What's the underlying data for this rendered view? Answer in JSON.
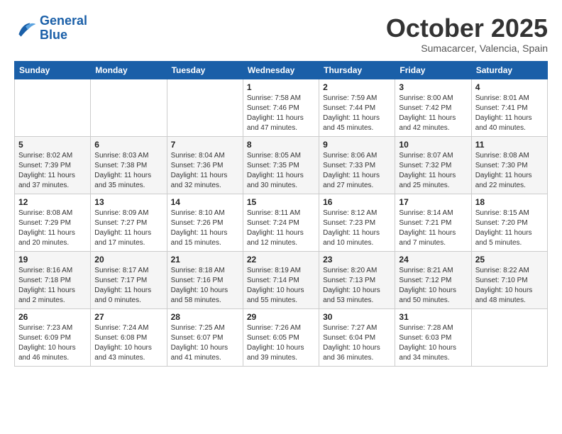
{
  "logo": {
    "line1": "General",
    "line2": "Blue"
  },
  "header": {
    "month": "October 2025",
    "location": "Sumacarcer, Valencia, Spain"
  },
  "days_of_week": [
    "Sunday",
    "Monday",
    "Tuesday",
    "Wednesday",
    "Thursday",
    "Friday",
    "Saturday"
  ],
  "weeks": [
    [
      {
        "day": "",
        "info": ""
      },
      {
        "day": "",
        "info": ""
      },
      {
        "day": "",
        "info": ""
      },
      {
        "day": "1",
        "info": "Sunrise: 7:58 AM\nSunset: 7:46 PM\nDaylight: 11 hours and 47 minutes."
      },
      {
        "day": "2",
        "info": "Sunrise: 7:59 AM\nSunset: 7:44 PM\nDaylight: 11 hours and 45 minutes."
      },
      {
        "day": "3",
        "info": "Sunrise: 8:00 AM\nSunset: 7:42 PM\nDaylight: 11 hours and 42 minutes."
      },
      {
        "day": "4",
        "info": "Sunrise: 8:01 AM\nSunset: 7:41 PM\nDaylight: 11 hours and 40 minutes."
      }
    ],
    [
      {
        "day": "5",
        "info": "Sunrise: 8:02 AM\nSunset: 7:39 PM\nDaylight: 11 hours and 37 minutes."
      },
      {
        "day": "6",
        "info": "Sunrise: 8:03 AM\nSunset: 7:38 PM\nDaylight: 11 hours and 35 minutes."
      },
      {
        "day": "7",
        "info": "Sunrise: 8:04 AM\nSunset: 7:36 PM\nDaylight: 11 hours and 32 minutes."
      },
      {
        "day": "8",
        "info": "Sunrise: 8:05 AM\nSunset: 7:35 PM\nDaylight: 11 hours and 30 minutes."
      },
      {
        "day": "9",
        "info": "Sunrise: 8:06 AM\nSunset: 7:33 PM\nDaylight: 11 hours and 27 minutes."
      },
      {
        "day": "10",
        "info": "Sunrise: 8:07 AM\nSunset: 7:32 PM\nDaylight: 11 hours and 25 minutes."
      },
      {
        "day": "11",
        "info": "Sunrise: 8:08 AM\nSunset: 7:30 PM\nDaylight: 11 hours and 22 minutes."
      }
    ],
    [
      {
        "day": "12",
        "info": "Sunrise: 8:08 AM\nSunset: 7:29 PM\nDaylight: 11 hours and 20 minutes."
      },
      {
        "day": "13",
        "info": "Sunrise: 8:09 AM\nSunset: 7:27 PM\nDaylight: 11 hours and 17 minutes."
      },
      {
        "day": "14",
        "info": "Sunrise: 8:10 AM\nSunset: 7:26 PM\nDaylight: 11 hours and 15 minutes."
      },
      {
        "day": "15",
        "info": "Sunrise: 8:11 AM\nSunset: 7:24 PM\nDaylight: 11 hours and 12 minutes."
      },
      {
        "day": "16",
        "info": "Sunrise: 8:12 AM\nSunset: 7:23 PM\nDaylight: 11 hours and 10 minutes."
      },
      {
        "day": "17",
        "info": "Sunrise: 8:14 AM\nSunset: 7:21 PM\nDaylight: 11 hours and 7 minutes."
      },
      {
        "day": "18",
        "info": "Sunrise: 8:15 AM\nSunset: 7:20 PM\nDaylight: 11 hours and 5 minutes."
      }
    ],
    [
      {
        "day": "19",
        "info": "Sunrise: 8:16 AM\nSunset: 7:18 PM\nDaylight: 11 hours and 2 minutes."
      },
      {
        "day": "20",
        "info": "Sunrise: 8:17 AM\nSunset: 7:17 PM\nDaylight: 11 hours and 0 minutes."
      },
      {
        "day": "21",
        "info": "Sunrise: 8:18 AM\nSunset: 7:16 PM\nDaylight: 10 hours and 58 minutes."
      },
      {
        "day": "22",
        "info": "Sunrise: 8:19 AM\nSunset: 7:14 PM\nDaylight: 10 hours and 55 minutes."
      },
      {
        "day": "23",
        "info": "Sunrise: 8:20 AM\nSunset: 7:13 PM\nDaylight: 10 hours and 53 minutes."
      },
      {
        "day": "24",
        "info": "Sunrise: 8:21 AM\nSunset: 7:12 PM\nDaylight: 10 hours and 50 minutes."
      },
      {
        "day": "25",
        "info": "Sunrise: 8:22 AM\nSunset: 7:10 PM\nDaylight: 10 hours and 48 minutes."
      }
    ],
    [
      {
        "day": "26",
        "info": "Sunrise: 7:23 AM\nSunset: 6:09 PM\nDaylight: 10 hours and 46 minutes."
      },
      {
        "day": "27",
        "info": "Sunrise: 7:24 AM\nSunset: 6:08 PM\nDaylight: 10 hours and 43 minutes."
      },
      {
        "day": "28",
        "info": "Sunrise: 7:25 AM\nSunset: 6:07 PM\nDaylight: 10 hours and 41 minutes."
      },
      {
        "day": "29",
        "info": "Sunrise: 7:26 AM\nSunset: 6:05 PM\nDaylight: 10 hours and 39 minutes."
      },
      {
        "day": "30",
        "info": "Sunrise: 7:27 AM\nSunset: 6:04 PM\nDaylight: 10 hours and 36 minutes."
      },
      {
        "day": "31",
        "info": "Sunrise: 7:28 AM\nSunset: 6:03 PM\nDaylight: 10 hours and 34 minutes."
      },
      {
        "day": "",
        "info": ""
      }
    ]
  ]
}
